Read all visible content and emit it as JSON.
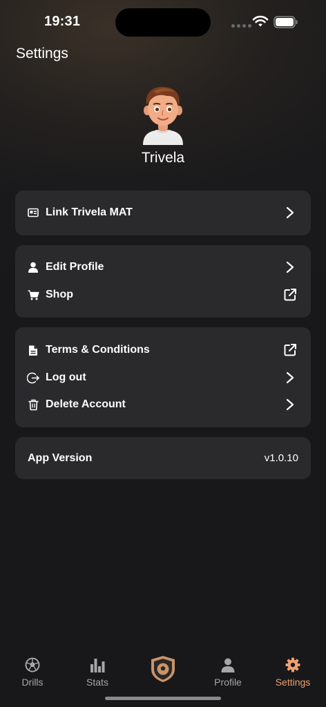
{
  "status_bar": {
    "time": "19:31"
  },
  "header": {
    "title": "Settings"
  },
  "profile": {
    "name": "Trivela"
  },
  "sections": {
    "device": {
      "link_mat": "Link Trivela MAT"
    },
    "account": {
      "edit_profile": "Edit Profile",
      "shop": "Shop"
    },
    "legal": {
      "terms": "Terms & Conditions",
      "logout": "Log out",
      "delete": "Delete Account"
    },
    "app": {
      "version_label": "App Version",
      "version_value": "v1.0.10"
    }
  },
  "tab_bar": {
    "tabs": [
      {
        "label": "Drills",
        "icon": "soccer-ball-icon"
      },
      {
        "label": "Stats",
        "icon": "bar-chart-icon"
      },
      {
        "label": "",
        "icon": "shield-ball-icon"
      },
      {
        "label": "Profile",
        "icon": "person-icon"
      },
      {
        "label": "Settings",
        "icon": "gear-icon"
      }
    ],
    "active": "Settings",
    "active_color": "#f0a070",
    "inactive_color": "#a6a6a6"
  },
  "colors": {
    "card": "#2a2a2d",
    "background": "#18181a"
  }
}
